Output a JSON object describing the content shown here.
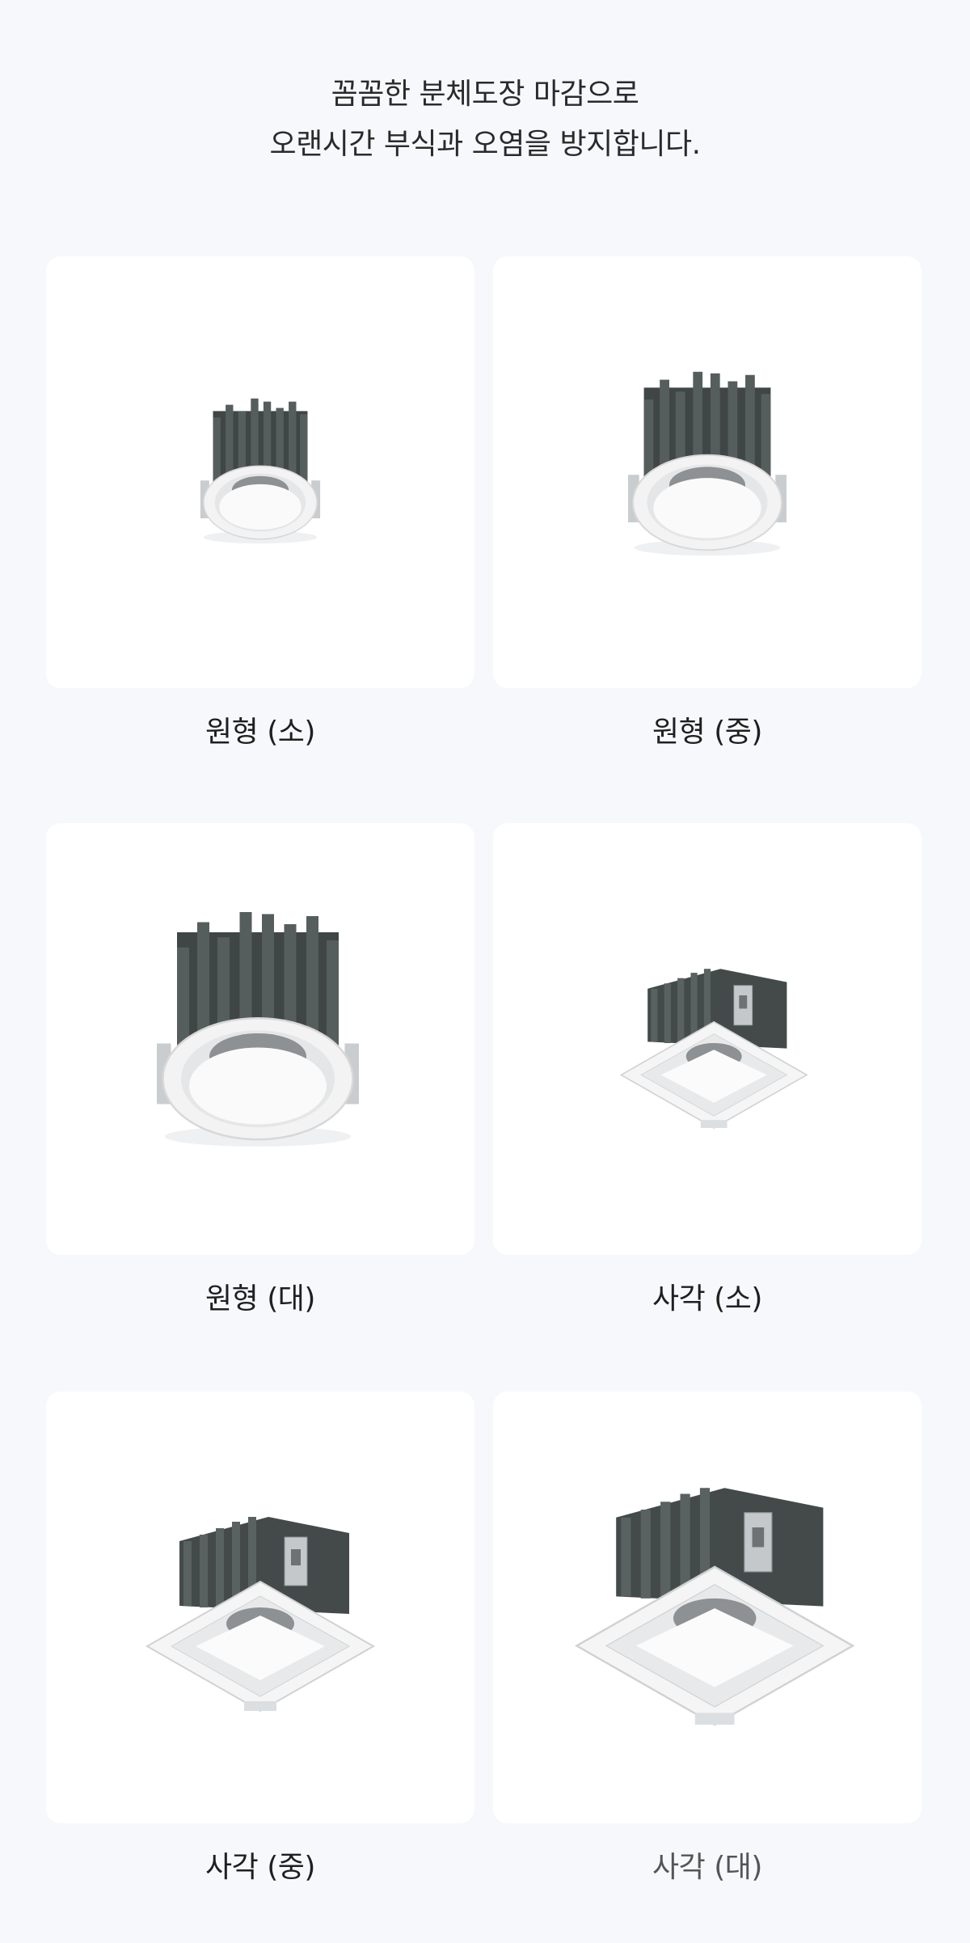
{
  "headline": {
    "line1": "꼼꼼한 분체도장 마감으로",
    "line2": "오랜시간 부식과 오염을 방지합니다."
  },
  "products": [
    {
      "label": "원형 (소)",
      "shape": "round",
      "size": "small"
    },
    {
      "label": "원형 (중)",
      "shape": "round",
      "size": "medium"
    },
    {
      "label": "원형 (대)",
      "shape": "round",
      "size": "large"
    },
    {
      "label": "사각 (소)",
      "shape": "square",
      "size": "small"
    },
    {
      "label": "사각 (중)",
      "shape": "square",
      "size": "medium"
    },
    {
      "label": "사각 (대)",
      "shape": "square",
      "size": "large"
    }
  ],
  "colors": {
    "background": "#f7f8fc",
    "card": "#ffffff",
    "heatsink": "#4a5150",
    "trim": "#f4f4f4"
  }
}
